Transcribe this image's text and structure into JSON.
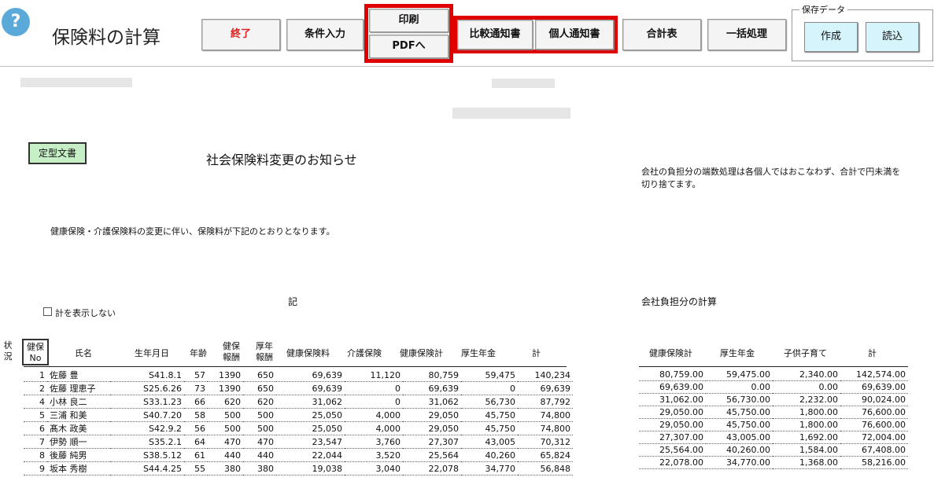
{
  "toolbar": {
    "help": "?",
    "title": "保険料の計算",
    "end": "終了",
    "conditions": "条件入力",
    "print": "印刷",
    "pdf": "PDFへ",
    "compare_notice": "比較通知書",
    "personal_notice": "個人通知書",
    "summary": "合計表",
    "batch": "一括処理",
    "save_legend": "保存データ",
    "create": "作成",
    "load": "読込"
  },
  "doc": {
    "template_button": "定型文書",
    "heading": "社会保険料変更のお知らせ",
    "intro": "健康保険・介護保険料の変更に伴い、保険料が下記のとおりとなります。",
    "rounding_note": "会社の負担分の端数処理は各個人ではおこなわず、合計で円未満を切り捨てます。",
    "ki": "記",
    "hide_total_label": "計を表示しない",
    "company_calc_title": "会社負担分の計算"
  },
  "left_table": {
    "headers": {
      "status": "状況",
      "kenpo_no": "健保No",
      "name": "氏名",
      "birth": "生年月日",
      "age": "年齢",
      "kenpo_pay": "健保報酬",
      "kosei_pay": "厚年報酬",
      "health_ins": "健康保険料",
      "care_ins": "介護保険",
      "health_total": "健康保険計",
      "pension": "厚生年金",
      "total": "計"
    },
    "rows": [
      {
        "no": "1",
        "name": "佐藤 豊",
        "birth": "S41.8.1",
        "age": "57",
        "kp": "1390",
        "kn": "650",
        "hi": "69,639",
        "ci": "11,120",
        "ht": "80,759",
        "pe": "59,475",
        "t": "140,234"
      },
      {
        "no": "2",
        "name": "佐藤 理恵子",
        "birth": "S25.6.26",
        "age": "73",
        "kp": "1390",
        "kn": "650",
        "hi": "69,639",
        "ci": "0",
        "ht": "69,639",
        "pe": "0",
        "t": "69,639"
      },
      {
        "no": "4",
        "name": "小林 良二",
        "birth": "S33.1.23",
        "age": "66",
        "kp": "620",
        "kn": "620",
        "hi": "31,062",
        "ci": "0",
        "ht": "31,062",
        "pe": "56,730",
        "t": "87,792"
      },
      {
        "no": "5",
        "name": "三浦 和美",
        "birth": "S40.7.20",
        "age": "58",
        "kp": "500",
        "kn": "500",
        "hi": "25,050",
        "ci": "4,000",
        "ht": "29,050",
        "pe": "45,750",
        "t": "74,800"
      },
      {
        "no": "6",
        "name": "髙木 政美",
        "birth": "S42.9.2",
        "age": "56",
        "kp": "500",
        "kn": "500",
        "hi": "25,050",
        "ci": "4,000",
        "ht": "29,050",
        "pe": "45,750",
        "t": "74,800"
      },
      {
        "no": "7",
        "name": "伊勢 順一",
        "birth": "S35.2.1",
        "age": "64",
        "kp": "470",
        "kn": "470",
        "hi": "23,547",
        "ci": "3,760",
        "ht": "27,307",
        "pe": "43,005",
        "t": "70,312"
      },
      {
        "no": "8",
        "name": "後藤 純男",
        "birth": "S38.5.12",
        "age": "61",
        "kp": "440",
        "kn": "440",
        "hi": "22,044",
        "ci": "3,520",
        "ht": "25,564",
        "pe": "40,260",
        "t": "65,824"
      },
      {
        "no": "9",
        "name": "坂本 秀樹",
        "birth": "S44.4.25",
        "age": "55",
        "kp": "380",
        "kn": "380",
        "hi": "19,038",
        "ci": "3,040",
        "ht": "22,078",
        "pe": "34,770",
        "t": "56,848"
      }
    ]
  },
  "right_table": {
    "headers": {
      "health_total": "健康保険計",
      "pension": "厚生年金",
      "child": "子供子育て",
      "total": "計"
    },
    "rows": [
      {
        "ht": "80,759.00",
        "pe": "59,475.00",
        "ch": "2,340.00",
        "t": "142,574.00"
      },
      {
        "ht": "69,639.00",
        "pe": "0.00",
        "ch": "0.00",
        "t": "69,639.00"
      },
      {
        "ht": "31,062.00",
        "pe": "56,730.00",
        "ch": "2,232.00",
        "t": "90,024.00"
      },
      {
        "ht": "29,050.00",
        "pe": "45,750.00",
        "ch": "1,800.00",
        "t": "76,600.00"
      },
      {
        "ht": "29,050.00",
        "pe": "45,750.00",
        "ch": "1,800.00",
        "t": "76,600.00"
      },
      {
        "ht": "27,307.00",
        "pe": "43,005.00",
        "ch": "1,692.00",
        "t": "72,004.00"
      },
      {
        "ht": "25,564.00",
        "pe": "40,260.00",
        "ch": "1,584.00",
        "t": "67,408.00"
      },
      {
        "ht": "22,078.00",
        "pe": "34,770.00",
        "ch": "1,368.00",
        "t": "58,216.00"
      }
    ]
  }
}
